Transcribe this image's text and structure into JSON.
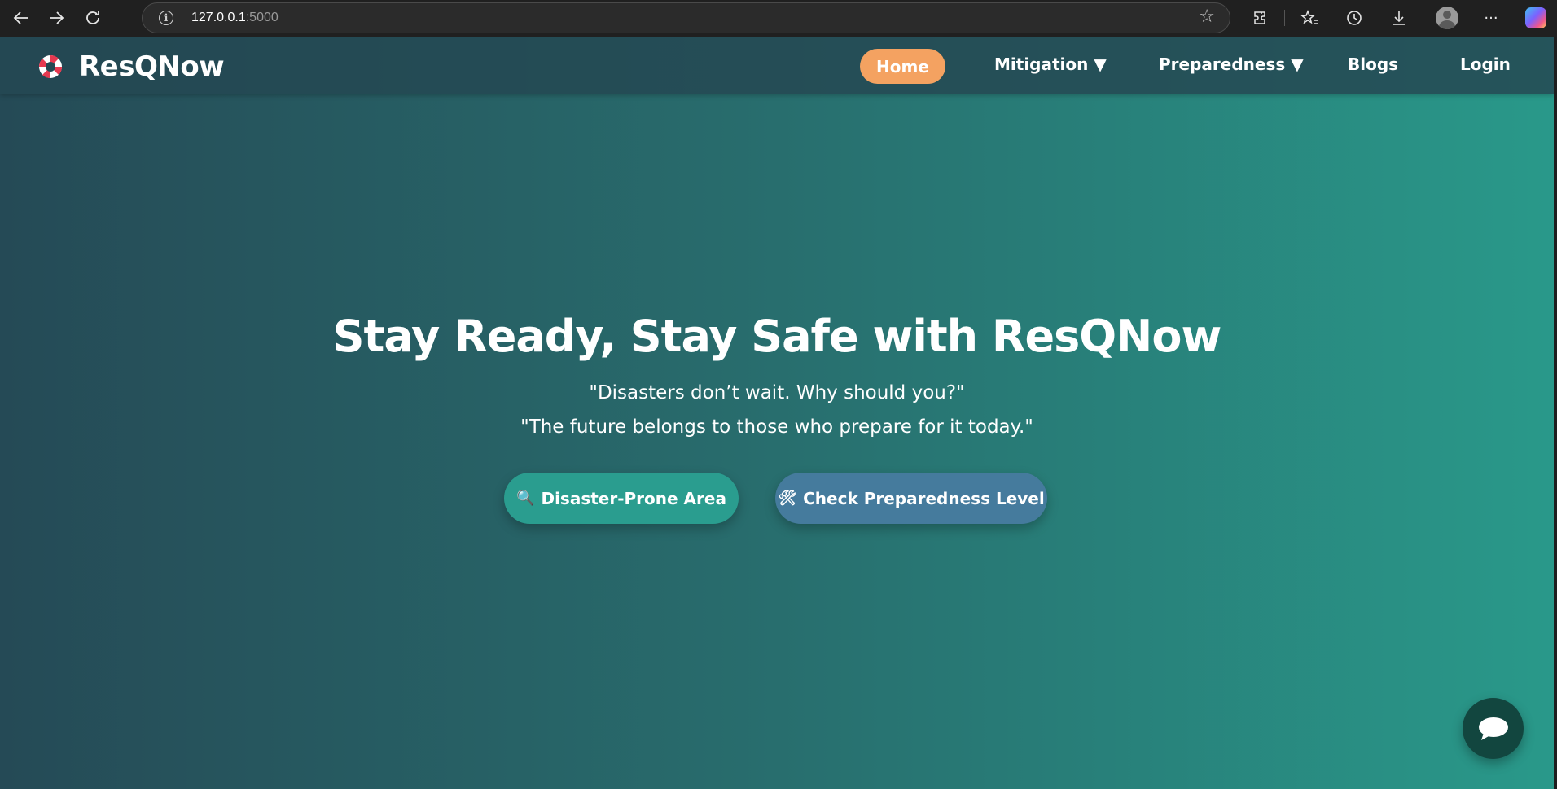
{
  "browser": {
    "back_icon": "arrow-left-icon",
    "forward_icon": "arrow-right-icon",
    "reload_icon": "reload-icon",
    "url_host": "127.0.0.1",
    "url_port": ":5000"
  },
  "site": {
    "brand": "ResQNow",
    "nav": {
      "home": "Home",
      "mitigation": "Mitigation ▼",
      "preparedness": "Preparedness ▼",
      "blogs": "Blogs",
      "login": "Login"
    }
  },
  "hero": {
    "title": "Stay Ready, Stay Safe with ResQNow",
    "quote_1": "\"Disasters don’t wait. Why should you?\"",
    "quote_2": "\"The future belongs to those who prepare for it today.\"",
    "btn_area": "Disaster-Prone Area",
    "btn_area_icon": "🔍",
    "btn_check": "Check Preparedness Level",
    "btn_check_icon": "🛠"
  },
  "colors": {
    "home_accent": "#f4a261",
    "btn_area": "#2a9d8f",
    "btn_check": "#457b9d",
    "chat": "#12463f"
  }
}
